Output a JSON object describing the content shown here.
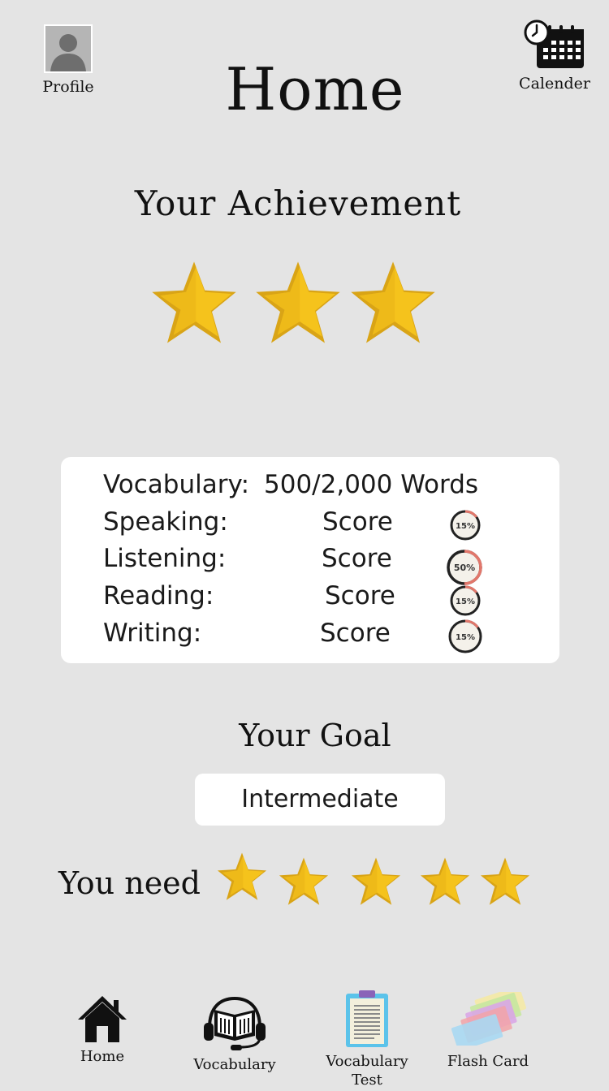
{
  "header": {
    "title": "Home",
    "profile_label": "Profile",
    "calendar_label": "Calender"
  },
  "achievement": {
    "title": "Your Achievement",
    "stars_earned": 3
  },
  "stats": {
    "vocabulary": {
      "label": "Vocabulary:",
      "value": "500/2,000 Words"
    },
    "rows": [
      {
        "label": "Speaking:",
        "value": "Score",
        "percent_text": "15%",
        "percent": 15
      },
      {
        "label": "Listening:",
        "value": "Score",
        "percent_text": "50%",
        "percent": 50
      },
      {
        "label": "Reading:",
        "value": "Score",
        "percent_text": "15%",
        "percent": 15
      },
      {
        "label": "Writing:",
        "value": "Score",
        "percent_text": "15%",
        "percent": 15
      }
    ]
  },
  "goal": {
    "title": "Your Goal",
    "level": "Intermediate",
    "need_label": "You need",
    "stars_needed": 5
  },
  "nav": [
    {
      "label": "Home",
      "icon": "house-icon"
    },
    {
      "label": "Vocabulary",
      "icon": "audio-book-icon"
    },
    {
      "label": "Vocabulary Test",
      "icon": "clipboard-icon"
    },
    {
      "label": "Flash Card",
      "icon": "flash-cards-icon"
    }
  ],
  "colors": {
    "background": "#e4e4e4",
    "star_gold": "#f5c31c",
    "star_shadow": "#d9a416",
    "ring_progress": "#e2776b",
    "clipboard": "#5bc3ea"
  }
}
